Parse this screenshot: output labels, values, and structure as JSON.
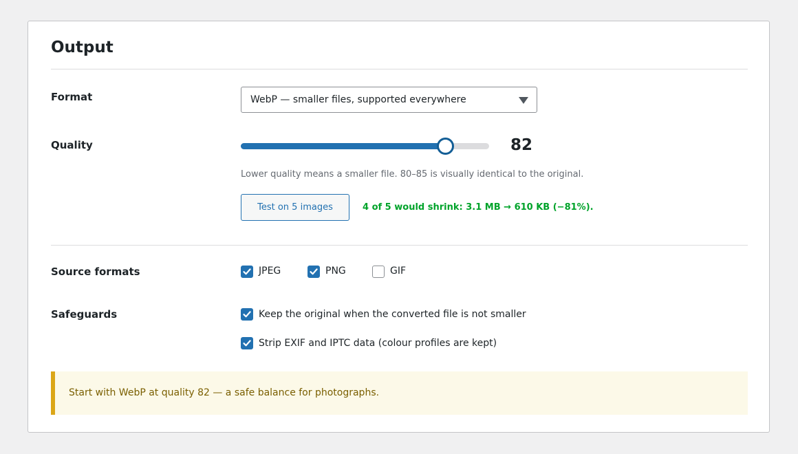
{
  "section": {
    "title": "Output"
  },
  "format": {
    "label": "Format",
    "selected": "WebP — smaller files, supported everywhere"
  },
  "quality": {
    "label": "Quality",
    "value": 82,
    "value_text": "82",
    "min": 0,
    "max": 100,
    "hint": "Lower quality means a smaller file. 80–85 is visually identical to the original.",
    "test_button": "Test on 5 images",
    "test_result": "4 of 5 would shrink: 3.1 MB → 610 KB (−81%)."
  },
  "source_formats": {
    "label": "Source formats",
    "items": [
      {
        "label": "JPEG",
        "checked": true
      },
      {
        "label": "PNG",
        "checked": true
      },
      {
        "label": "GIF",
        "checked": false
      }
    ]
  },
  "safeguards": {
    "label": "Safeguards",
    "items": [
      {
        "label": "Keep the original when the converted file is not smaller",
        "checked": true
      },
      {
        "label": "Strip EXIF and IPTC data (colour profiles are kept)",
        "checked": true
      }
    ]
  },
  "notice": {
    "text": "Start with WebP at quality 82 — a safe balance for photographs."
  },
  "colors": {
    "accent": "#2271b1",
    "success": "#00a32a",
    "notice_border": "#dba617",
    "notice_bg": "#fcf9e8"
  },
  "icons": {
    "select_caret": "caret-down-icon",
    "checkbox_check": "check-icon"
  }
}
